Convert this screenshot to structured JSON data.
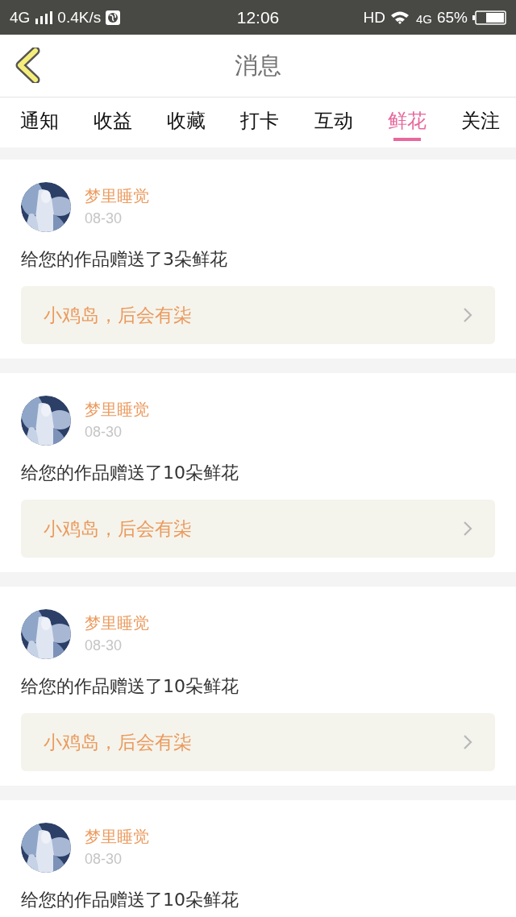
{
  "status_bar": {
    "network": "4G",
    "speed": "0.4K/s",
    "time": "12:06",
    "hd": "HD",
    "data_network": "4G",
    "battery": "65%"
  },
  "header": {
    "title": "消息"
  },
  "tabs": [
    {
      "label": "通知",
      "selected": false
    },
    {
      "label": "收益",
      "selected": false
    },
    {
      "label": "收藏",
      "selected": false
    },
    {
      "label": "打卡",
      "selected": false
    },
    {
      "label": "互动",
      "selected": false
    },
    {
      "label": "鲜花",
      "selected": true
    },
    {
      "label": "关注",
      "selected": false
    }
  ],
  "messages": [
    {
      "user": "梦里睡觉",
      "date": "08-30",
      "text": "给您的作品赠送了3朵鲜花",
      "work": "小鸡岛，后会有柒"
    },
    {
      "user": "梦里睡觉",
      "date": "08-30",
      "text": "给您的作品赠送了10朵鲜花",
      "work": "小鸡岛，后会有柒"
    },
    {
      "user": "梦里睡觉",
      "date": "08-30",
      "text": "给您的作品赠送了10朵鲜花",
      "work": "小鸡岛，后会有柒"
    },
    {
      "user": "梦里睡觉",
      "date": "08-30",
      "text": "给您的作品赠送了10朵鲜花"
    }
  ]
}
